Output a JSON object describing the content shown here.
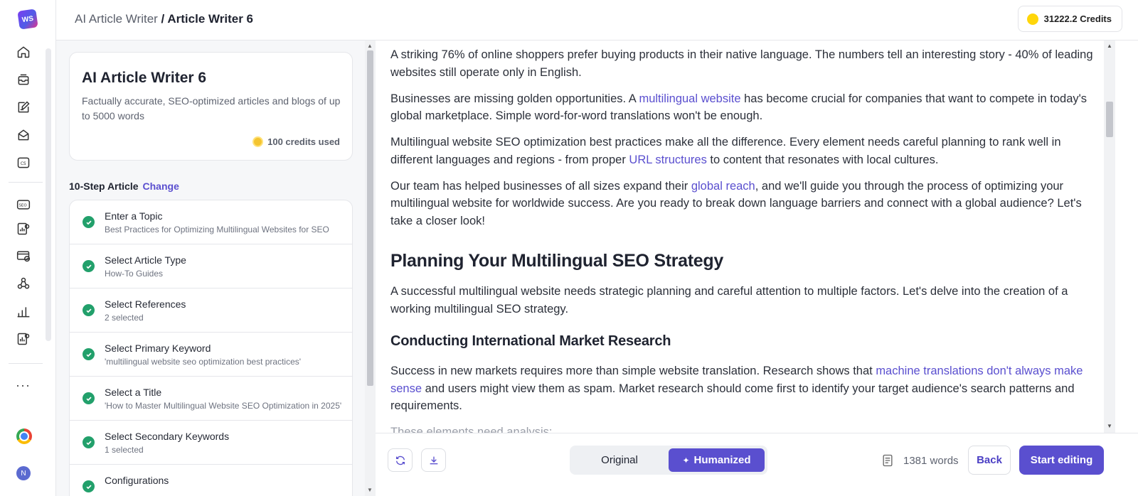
{
  "app": {
    "logo_text": "WS"
  },
  "rail": {
    "items": [
      {
        "icon": "home-icon"
      },
      {
        "icon": "inbox-icon"
      },
      {
        "icon": "edit-note-icon"
      },
      {
        "icon": "mail-tray-icon"
      },
      {
        "icon": "cs-icon"
      },
      {
        "icon": "seo-icon"
      },
      {
        "icon": "analytics-doc-icon"
      },
      {
        "icon": "card-check-icon"
      },
      {
        "icon": "network-icon"
      },
      {
        "icon": "bar-chart-icon"
      },
      {
        "icon": "report-icon"
      }
    ],
    "more": "···",
    "avatar": "N"
  },
  "header": {
    "breadcrumb_parent": "AI Article Writer",
    "breadcrumb_sep": " / ",
    "breadcrumb_current": "Article Writer 6",
    "credits": "31222.2 Credits"
  },
  "card": {
    "title": "AI Article Writer 6",
    "description": "Factually accurate, SEO-optimized articles and blogs of up to 5000 words",
    "credits_used": "100 credits used"
  },
  "steps_header": {
    "label": "10-Step Article",
    "change": "Change"
  },
  "steps": [
    {
      "title": "Enter a Topic",
      "sub": "Best Practices for Optimizing Multilingual Websites for SEO"
    },
    {
      "title": "Select Article Type",
      "sub": "How-To Guides"
    },
    {
      "title": "Select References",
      "sub": "2 selected"
    },
    {
      "title": "Select Primary Keyword",
      "sub": "'multilingual website seo optimization best practices'"
    },
    {
      "title": "Select a Title",
      "sub": "'How to Master Multilingual Website SEO Optimization in 2025'"
    },
    {
      "title": "Select Secondary Keywords",
      "sub": "1 selected"
    },
    {
      "title": "Configurations",
      "sub": ""
    }
  ],
  "article": {
    "p1": "A striking 76% of online shoppers prefer buying products in their native language. The numbers tell an interesting story - 40% of leading websites still operate only in English.",
    "p2_a": "Businesses are missing golden opportunities. A ",
    "p2_link": "multilingual website",
    "p2_b": " has become crucial for companies that want to compete in today's global marketplace. Simple word-for-word translations won't be enough.",
    "p3_a": "Multilingual website SEO optimization best practices make all the difference. Every element needs careful planning to rank well in different languages and regions - from proper ",
    "p3_link": "URL structures",
    "p3_b": " to content that resonates with local cultures.",
    "p4_a": "Our team has helped businesses of all sizes expand their ",
    "p4_link": "global reach",
    "p4_b": ", and we'll guide you through the process of optimizing your multilingual website for worldwide success. Are you ready to break down language barriers and connect with a global audience? Let's take a closer look!",
    "h2": "Planning Your Multilingual SEO Strategy",
    "p5": "A successful multilingual website needs strategic planning and careful attention to multiple factors. Let's delve into the creation of a working multilingual SEO strategy.",
    "h3": "Conducting International Market Research",
    "p6_a": "Success in new markets requires more than simple website translation. Research shows that ",
    "p6_link": "machine translations don't always make sense",
    "p6_b": " and users might view them as spam. Market research should come first to identify your target audience's search patterns and requirements.",
    "p7": "These elements need analysis:"
  },
  "bottom": {
    "toggle_original": "Original",
    "toggle_humanized": "Humanized",
    "word_count": "1381 words",
    "back": "Back",
    "start_editing": "Start editing"
  }
}
